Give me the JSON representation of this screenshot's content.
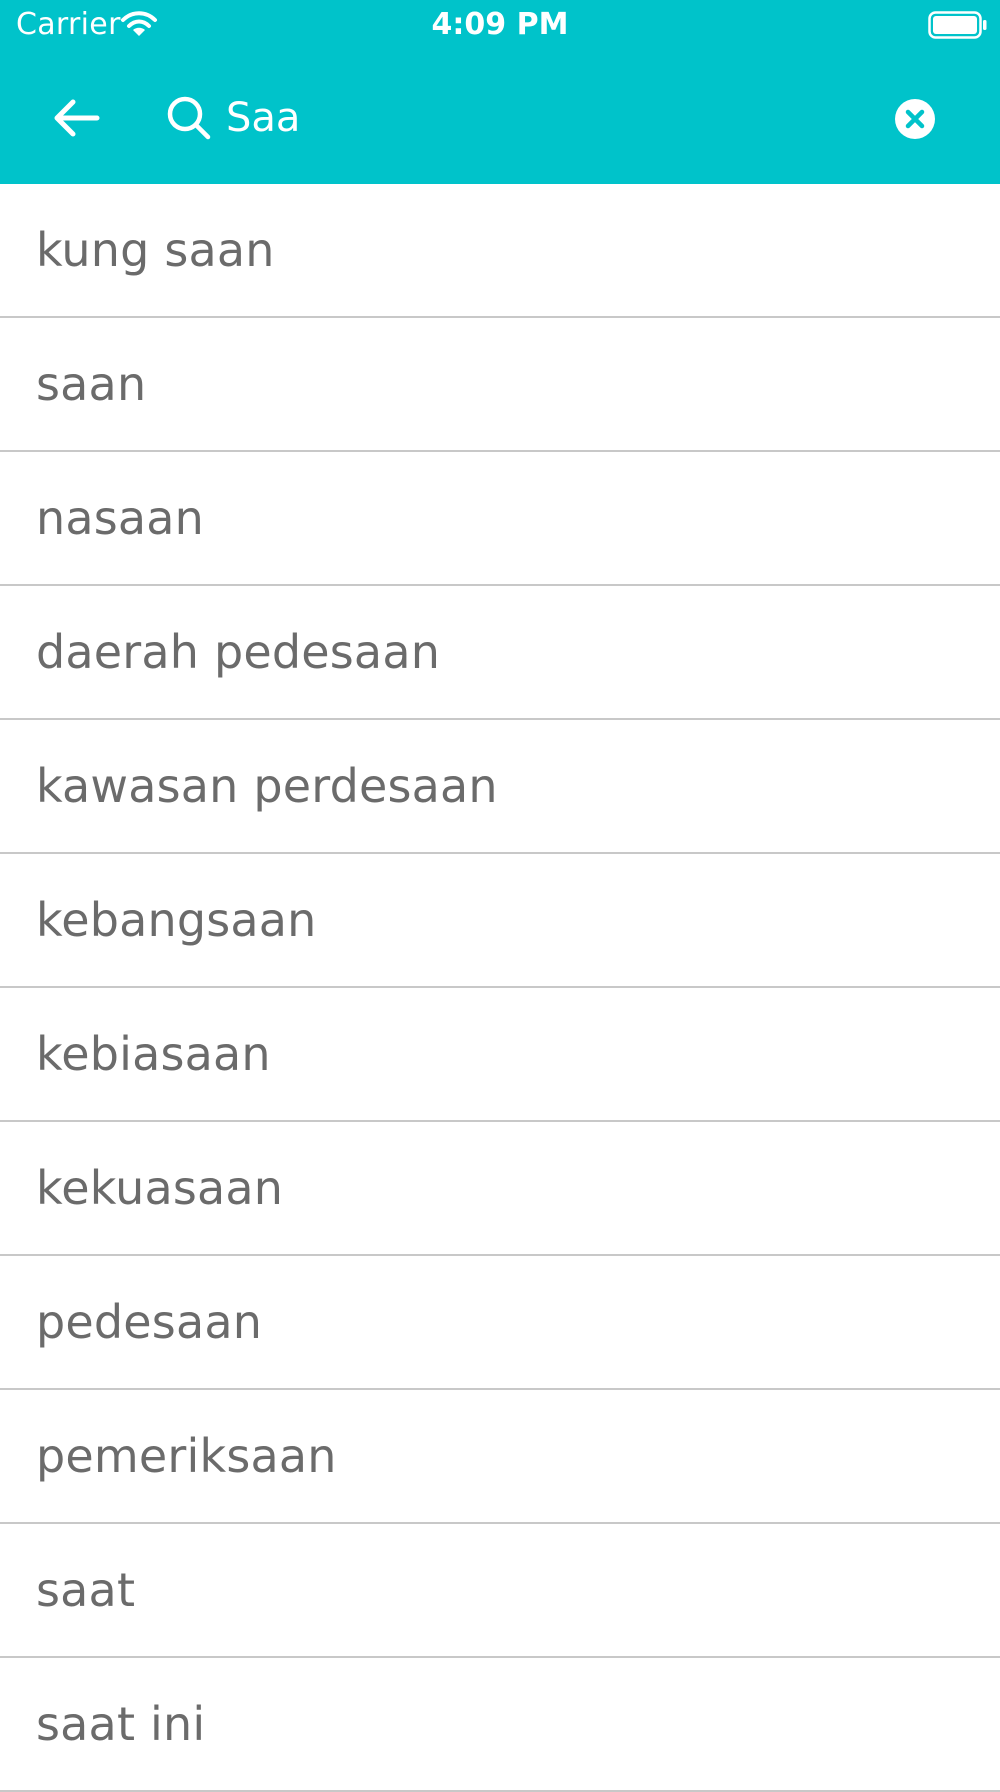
{
  "status_bar": {
    "carrier": "Carrier",
    "time": "4:09 PM"
  },
  "search": {
    "value": "Saa",
    "placeholder": ""
  },
  "colors": {
    "header_background": "#00C3CA",
    "item_text": "#6B6B6B",
    "divider": "#C8C8C8"
  },
  "icons": {
    "back": "arrow-left-icon",
    "search": "magnifier-icon",
    "clear": "clear-circle-x-icon",
    "wifi": "wifi-icon",
    "battery": "battery-icon"
  },
  "results": [
    {
      "label": "kung saan"
    },
    {
      "label": "saan"
    },
    {
      "label": "nasaan"
    },
    {
      "label": "daerah pedesaan"
    },
    {
      "label": "kawasan perdesaan"
    },
    {
      "label": "kebangsaan"
    },
    {
      "label": "kebiasaan"
    },
    {
      "label": "kekuasaan"
    },
    {
      "label": "pedesaan"
    },
    {
      "label": "pemeriksaan"
    },
    {
      "label": "saat"
    },
    {
      "label": "saat ini"
    }
  ]
}
